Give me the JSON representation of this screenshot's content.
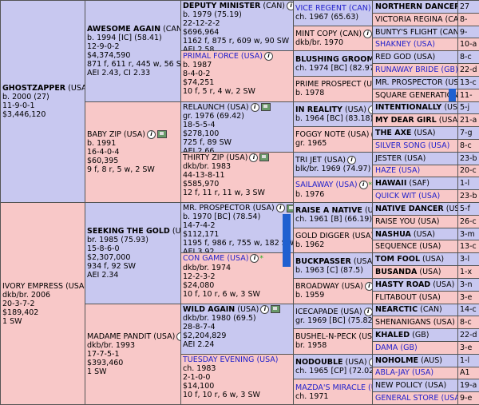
{
  "gen1": {
    "sire": {
      "name": "GHOSTZAPPER",
      "country": "(USA)",
      "lines": [
        "b. 2000 (27)",
        "11-9-0-1",
        "$3,446,120"
      ]
    },
    "dam": {
      "name": "IVORY EMPRESS",
      "country": "(USA)",
      "lines": [
        "dkb/br. 2006",
        "20-3-7-2",
        "$189,402",
        "1 SW"
      ]
    }
  },
  "gen2": [
    {
      "name": "AWESOME AGAIN",
      "country": "(CAN)",
      "lines": [
        "b. 1994 [IC] (58.41)",
        "12-9-0-2",
        "$4,374,590",
        "871 f, 611 r, 445 w, 56 SW",
        "AEI 2.43, CI 2.33"
      ]
    },
    {
      "name": "BABY ZIP",
      "country": "(USA)",
      "lines": [
        "b. 1991",
        "16-4-0-4",
        "$60,395",
        "9 f, 8 r, 5 w, 2 SW"
      ]
    },
    {
      "name": "SEEKING THE GOLD",
      "country": "(USA)",
      "lines": [
        "br. 1985 (75.93)",
        "15-8-6-0",
        "$2,307,000",
        "934 f, 92 SW",
        "AEI 2.34"
      ]
    },
    {
      "name": "MADAME PANDIT",
      "country": "(USA)",
      "lines": [
        "dkb/br. 1993",
        "17-7-5-1",
        "$393,460",
        "1 SW"
      ]
    }
  ],
  "gen3": [
    {
      "name": "DEPUTY MINISTER",
      "country": "(CAN)",
      "lines": [
        "b. 1979 (75.19)",
        "22-12-2-2",
        "$696,964",
        "1162 f, 875 r, 609 w, 90 SW",
        "AEI 2.58"
      ],
      "link": "Website"
    },
    {
      "name": "PRIMAL FORCE",
      "country": "(USA)",
      "lines": [
        "b. 1987",
        "8-4-0-2",
        "$74,251",
        "10 f, 5 r, 4 w, 2 SW"
      ]
    },
    {
      "name": "RELAUNCH",
      "country": "(USA)",
      "lines": [
        "gr. 1976 (69.42)",
        "18-5-5-4",
        "$278,100",
        "725 f, 89 SW",
        "AEI 2.66"
      ]
    },
    {
      "name": "THIRTY ZIP",
      "country": "(USA)",
      "lines": [
        "dkb/br. 1983",
        "44-13-8-11",
        "$585,970",
        "12 f, 11 r, 11 w, 3 SW"
      ]
    },
    {
      "name": "MR. PROSPECTOR",
      "country": "(USA)",
      "lines": [
        "b. 1970 [BC] (78.54)",
        "14-7-4-2",
        "$112,171",
        "1195 f, 986 r, 755 w, 182 SW",
        "AEI 3.92"
      ]
    },
    {
      "name": "CON GAME",
      "country": "(USA)",
      "lines": [
        "dkb/br. 1974",
        "12-2-3-2",
        "$24,080",
        "10 f, 10 r, 6 w, 3 SW"
      ]
    },
    {
      "name": "WILD AGAIN",
      "country": "(USA)",
      "lines": [
        "dkb/br. 1980 (69.5)",
        "28-8-7-4",
        "$2,204,829",
        "AEI 2.24"
      ]
    },
    {
      "name": "TUESDAY EVENING",
      "country": "(USA)",
      "lines": [
        "ch. 1983",
        "2-1-0-0",
        "$14,100",
        "10 f, 10 r, 6 w, 3 SW"
      ]
    }
  ],
  "gen4": [
    {
      "name": "VICE REGENT",
      "country": "(CAN)",
      "line": "ch. 1967 (65.63)"
    },
    {
      "name": "MINT COPY",
      "country": "(CAN)",
      "line": "dkb/br. 1970"
    },
    {
      "name": "BLUSHING GROOM",
      "country": "(FR)",
      "line": "ch. 1974 [BC] (82.97)"
    },
    {
      "name": "PRIME PROSPECT",
      "country": "(USA)",
      "line": "b. 1978"
    },
    {
      "name": "IN REALITY",
      "country": "(USA)",
      "line": "b. 1964 [BC] (83.18)"
    },
    {
      "name": "FOGGY NOTE",
      "country": "(USA)",
      "line": "gr. 1965"
    },
    {
      "name": "TRI JET",
      "country": "(USA)",
      "line": "blk/br. 1969 (74.97)"
    },
    {
      "name": "SAILAWAY",
      "country": "(USA)",
      "line": "b. 1976"
    },
    {
      "name": "RAISE A NATIVE",
      "country": "(USA)",
      "line": "ch. 1961 [B] (66.19)"
    },
    {
      "name": "GOLD DIGGER",
      "country": "(USA)",
      "line": "b. 1962"
    },
    {
      "name": "BUCKPASSER",
      "country": "(USA)",
      "line": "b. 1963 [C] (87.5)"
    },
    {
      "name": "BROADWAY",
      "country": "(USA)",
      "line": "b. 1959"
    },
    {
      "name": "ICECAPADE",
      "country": "(USA)",
      "line": "gr. 1969 [BC] (75.82)"
    },
    {
      "name": "BUSHEL-N-PECK",
      "country": "(USA)",
      "line": "br. 1958"
    },
    {
      "name": "NODOUBLE",
      "country": "(USA)",
      "line": "ch. 1965 [CP] (72.02)"
    },
    {
      "name": "MAZDA'S MIRACLE",
      "country": "(USA)",
      "line": "ch. 1971"
    }
  ],
  "gen5": [
    {
      "name": "NORTHERN DANCER",
      "country": "",
      "extra": "27"
    },
    {
      "name": "VICTORIA REGINA",
      "country": "(CAN)",
      "extra": "8-"
    },
    {
      "name": "BUNTY'S FLIGHT",
      "country": "(CAN)",
      "extra": "9-"
    },
    {
      "name": "SHAKNEY",
      "country": "(USA)",
      "extra": "10-a"
    },
    {
      "name": "RED GOD",
      "country": "(USA)",
      "extra": "8-c"
    },
    {
      "name": "RUNAWAY BRIDE",
      "country": "(GB)",
      "extra": "22-d"
    },
    {
      "name": "MR. PROSPECTOR",
      "country": "(USA)",
      "extra": "13-c"
    },
    {
      "name": "SQUARE GENERATION",
      "country": "",
      "extra": "11-"
    },
    {
      "name": "INTENTIONALLY",
      "country": "(USA)",
      "extra": "5-j"
    },
    {
      "name": "MY DEAR GIRL",
      "country": "(USA)",
      "extra": "21-a"
    },
    {
      "name": "THE AXE",
      "country": "(USA)",
      "extra": "7-g"
    },
    {
      "name": "SILVER SONG",
      "country": "(USA)",
      "extra": "8-c"
    },
    {
      "name": "JESTER",
      "country": "(USA)",
      "extra": "23-b"
    },
    {
      "name": "HAZE",
      "country": "(USA)",
      "extra": "20-c"
    },
    {
      "name": "HAWAII",
      "country": "(SAF)",
      "extra": "1-l"
    },
    {
      "name": "QUICK WIT",
      "country": "(USA)",
      "extra": "23-b"
    },
    {
      "name": "NATIVE DANCER",
      "country": "(USA)",
      "extra": "5-f"
    },
    {
      "name": "RAISE YOU",
      "country": "(USA)",
      "extra": "26-c"
    },
    {
      "name": "NASHUA",
      "country": "(USA)",
      "extra": "3-m"
    },
    {
      "name": "SEQUENCE",
      "country": "(USA)",
      "extra": "13-c"
    },
    {
      "name": "TOM FOOL",
      "country": "(USA)",
      "extra": "3-l"
    },
    {
      "name": "BUSANDA",
      "country": "(USA)",
      "extra": "1-x"
    },
    {
      "name": "HASTY ROAD",
      "country": "(USA)",
      "extra": "3-n"
    },
    {
      "name": "FLITABOUT",
      "country": "(USA)",
      "extra": "3-e"
    },
    {
      "name": "NEARCTIC",
      "country": "(CAN)",
      "extra": "14-c"
    },
    {
      "name": "SHENANIGANS",
      "country": "(USA)",
      "extra": "8-c"
    },
    {
      "name": "KHALED",
      "country": "(GB)",
      "extra": "22-d"
    },
    {
      "name": "DAMA",
      "country": "(GB)",
      "extra": "3-e"
    },
    {
      "name": "NOHOLME",
      "country": "(AUS)",
      "extra": "1-l"
    },
    {
      "name": "ABLA-JAY",
      "country": "(USA)",
      "extra": "A1"
    },
    {
      "name": "NEW POLICY",
      "country": "(USA)",
      "extra": "19-a"
    },
    {
      "name": "GENERAL STORE",
      "country": "(USA)",
      "extra": "9-e"
    }
  ]
}
